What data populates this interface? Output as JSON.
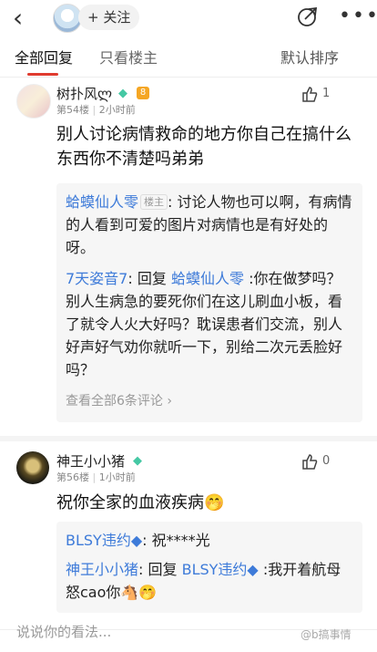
{
  "header": {
    "follow_label": "+ 关注"
  },
  "tabs": {
    "all_replies": "全部回复",
    "op_only": "只看楼主",
    "sort": "默认排序"
  },
  "comments": [
    {
      "username": "树扑风ლ",
      "level": "8",
      "floor": "第54楼",
      "time": "2小时前",
      "likes": "1",
      "content": "别人讨论病情救命的地方你自己在搞什么东西你不清楚吗弟弟",
      "replies": [
        {
          "author": "蛤蟆仙人零",
          "op_tag": "楼主",
          "sep": ":",
          "text": "讨论人物也可以啊，有病情的人看到可爱的图片对病情也是有好处的呀。"
        },
        {
          "author": "7天姿音7",
          "sep": ":",
          "prefix": "回复",
          "target": "蛤蟆仙人零",
          "text": ":你在做梦吗？别人生病急的要死你们在这儿刷血小板，看了就令人火大好吗？耽误患者们交流，别人好声好气劝你就听一下，别给二次元丢脸好吗？"
        }
      ],
      "view_all": "查看全部6条评论"
    },
    {
      "username": "神王小小猪",
      "floor": "第56楼",
      "time": "1小时前",
      "likes": "0",
      "content": "祝你全家的血液疾病",
      "emoji": "🤭",
      "replies": [
        {
          "author": "BLSY违约◆",
          "sep": ":",
          "text": "祝****光"
        },
        {
          "author": "神王小小猪",
          "sep": ":",
          "prefix": "回复",
          "target": "BLSY违约◆",
          "text": ":我开着航母怒cao你",
          "emoji": "🐴🤭"
        }
      ]
    }
  ],
  "bottom": {
    "placeholder": "说说你的看法...",
    "watermark": "@b搞事情"
  },
  "colors": {
    "accent_red": "#e03b2f",
    "link_blue": "#3e7bd9",
    "vip_green": "#45c8a4",
    "level_orange": "#f5a623"
  }
}
